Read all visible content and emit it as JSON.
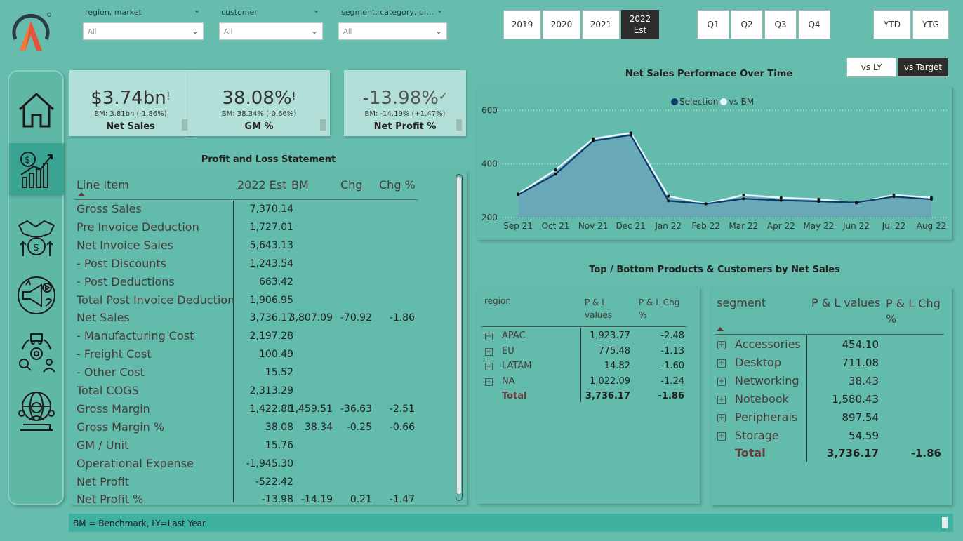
{
  "filters": [
    {
      "label": "region, market",
      "value": "All"
    },
    {
      "label": "customer",
      "value": "All"
    },
    {
      "label": "segment, category, pr...",
      "value": "All"
    }
  ],
  "years": [
    {
      "label": "2019",
      "active": false
    },
    {
      "label": "2020",
      "active": false
    },
    {
      "label": "2021",
      "active": false
    },
    {
      "label": "2022",
      "label2": "Est",
      "active": true
    }
  ],
  "quarters": [
    "Q1",
    "Q2",
    "Q3",
    "Q4"
  ],
  "periods": [
    "YTD",
    "YTG"
  ],
  "compare": {
    "vs_ly": "vs LY",
    "vs_target": "vs Target"
  },
  "kpis": [
    {
      "value": "$3.74bn",
      "mark": "!",
      "bm": "BM: 3.81bn (-1.86%)",
      "label": "Net Sales"
    },
    {
      "value": "38.08%",
      "mark": "!",
      "bm": "BM: 38.34% (-0.66%)",
      "label": "GM %"
    },
    {
      "value": "-13.98%",
      "mark": "✓",
      "bm": "BM: -14.19% (+1.47%)",
      "label": "Net Profit %"
    }
  ],
  "pnl": {
    "title": "Profit and Loss Statement",
    "headers": [
      "Line Item",
      "2022 Est",
      "BM",
      "Chg",
      "Chg %"
    ],
    "rows": [
      {
        "item": "Gross Sales",
        "est": "7,370.14",
        "bm": "",
        "chg": "",
        "pct": ""
      },
      {
        "item": "Pre Invoice Deduction",
        "est": "1,727.01",
        "bm": "",
        "chg": "",
        "pct": ""
      },
      {
        "item": "Net Invoice Sales",
        "est": "5,643.13",
        "bm": "",
        "chg": "",
        "pct": ""
      },
      {
        "item": "- Post Discounts",
        "est": "1,243.54",
        "bm": "",
        "chg": "",
        "pct": ""
      },
      {
        "item": "- Post Deductions",
        "est": "663.42",
        "bm": "",
        "chg": "",
        "pct": ""
      },
      {
        "item": "Total Post Invoice Deduction",
        "est": "1,906.95",
        "bm": "",
        "chg": "",
        "pct": ""
      },
      {
        "item": "Net Sales",
        "est": "3,736.17",
        "bm": "3,807.09",
        "chg": "-70.92",
        "pct": "-1.86"
      },
      {
        "item": "- Manufacturing Cost",
        "est": "2,197.28",
        "bm": "",
        "chg": "",
        "pct": ""
      },
      {
        "item": "- Freight Cost",
        "est": "100.49",
        "bm": "",
        "chg": "",
        "pct": ""
      },
      {
        "item": "- Other Cost",
        "est": "15.52",
        "bm": "",
        "chg": "",
        "pct": ""
      },
      {
        "item": "Total COGS",
        "est": "2,313.29",
        "bm": "",
        "chg": "",
        "pct": ""
      },
      {
        "item": "Gross Margin",
        "est": "1,422.88",
        "bm": "1,459.51",
        "chg": "-36.63",
        "pct": "-2.51"
      },
      {
        "item": "Gross Margin %",
        "est": "38.08",
        "bm": "38.34",
        "chg": "-0.25",
        "pct": "-0.66"
      },
      {
        "item": "GM / Unit",
        "est": "15.76",
        "bm": "",
        "chg": "",
        "pct": ""
      },
      {
        "item": "Operational Expense",
        "est": "-1,945.30",
        "bm": "",
        "chg": "",
        "pct": ""
      },
      {
        "item": "Net Profit",
        "est": "-522.42",
        "bm": "",
        "chg": "",
        "pct": ""
      },
      {
        "item": "Net Profit %",
        "est": "-13.98",
        "bm": "-14.19",
        "chg": "0.21",
        "pct": "-1.47"
      }
    ]
  },
  "chart_data": {
    "type": "area",
    "title": "Net Sales Performace Over Time",
    "categories": [
      "Sep 21",
      "Oct 21",
      "Nov 21",
      "Dec 21",
      "Jan 22",
      "Feb 22",
      "Mar 22",
      "Apr 22",
      "May 22",
      "Jun 22",
      "Jul 22",
      "Aug 22"
    ],
    "series": [
      {
        "name": "Selection",
        "color": "#0b3a6b",
        "values": [
          285,
          362,
          486,
          508,
          262,
          251,
          270,
          264,
          260,
          256,
          278,
          268
        ]
      },
      {
        "name": "vs BM",
        "color": "#e8f7ff",
        "values": [
          288,
          378,
          494,
          516,
          280,
          251,
          284,
          274,
          268,
          254,
          284,
          274
        ]
      }
    ],
    "ylim": [
      200,
      640
    ],
    "yticks": [
      200,
      400,
      600
    ],
    "grid": true,
    "legend": "top"
  },
  "toplist_title": "Top / Bottom Products & Customers by Net Sales",
  "region_table": {
    "headers": [
      "region",
      "P & L values",
      "P & L Chg %"
    ],
    "rows": [
      {
        "name": "APAC",
        "val": "1,923.77",
        "chg": "-2.48"
      },
      {
        "name": "EU",
        "val": "775.48",
        "chg": "-1.13"
      },
      {
        "name": "LATAM",
        "val": "14.82",
        "chg": "-1.60"
      },
      {
        "name": "NA",
        "val": "1,022.09",
        "chg": "-1.24"
      }
    ],
    "total": {
      "name": "Total",
      "val": "3,736.17",
      "chg": "-1.86"
    }
  },
  "segment_table": {
    "headers": [
      "segment",
      "P & L values",
      "P & L Chg %"
    ],
    "rows": [
      {
        "name": "Accessories",
        "val": "454.10"
      },
      {
        "name": "Desktop",
        "val": "711.08"
      },
      {
        "name": "Networking",
        "val": "38.43"
      },
      {
        "name": "Notebook",
        "val": "1,580.43"
      },
      {
        "name": "Peripherals",
        "val": "897.54"
      },
      {
        "name": "Storage",
        "val": "54.59"
      }
    ],
    "total": {
      "name": "Total",
      "val": "3,736.17",
      "chg": "-1.86"
    }
  },
  "footer": "BM = Benchmark, LY=Last Year",
  "colors": {
    "accent": "#3aa493",
    "dark": "#2d2d2d",
    "line_selection": "#0b3a6b",
    "line_bm": "#e8f7ff"
  }
}
